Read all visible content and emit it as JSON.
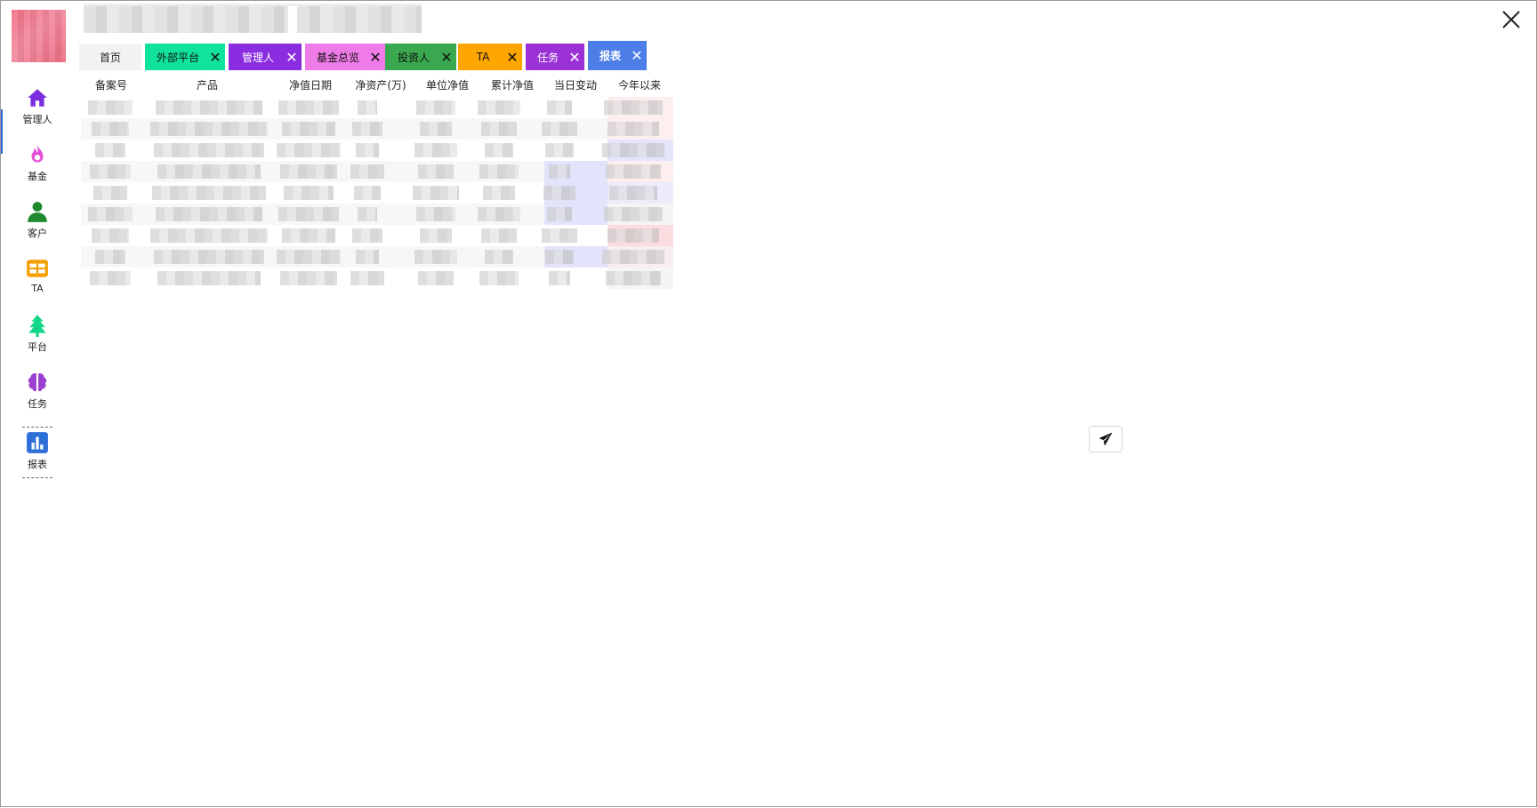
{
  "sidebar": {
    "items": [
      {
        "label": "管理人",
        "icon": "home-icon",
        "color": "#7a2ee0"
      },
      {
        "label": "基金",
        "icon": "fire-icon",
        "color": "#e34fd8"
      },
      {
        "label": "客户",
        "icon": "user-icon",
        "color": "#1f8a2e"
      },
      {
        "label": "TA",
        "icon": "table-icon",
        "color": "#f5a000"
      },
      {
        "label": "平台",
        "icon": "tree-icon",
        "color": "#14d68a"
      },
      {
        "label": "任务",
        "icon": "brain-icon",
        "color": "#9b3fd0"
      },
      {
        "label": "报表",
        "icon": "bar-chart-icon",
        "color": "#2f6fd8"
      }
    ]
  },
  "tabs": [
    {
      "label": "首页",
      "color": "#f2f2f2",
      "closable": false
    },
    {
      "label": "外部平台",
      "color": "#12e39a",
      "closable": true
    },
    {
      "label": "管理人",
      "color": "#8a2ce0",
      "closable": true
    },
    {
      "label": "基金总览",
      "color": "#ef7be8",
      "closable": true
    },
    {
      "label": "投资人",
      "color": "#3aa84f",
      "closable": true
    },
    {
      "label": "TA",
      "color": "#ffa500",
      "closable": true
    },
    {
      "label": "任务",
      "color": "#9a30d6",
      "closable": true
    },
    {
      "label": "报表",
      "color": "#4d7ee8",
      "closable": true,
      "active": true
    }
  ],
  "table": {
    "headers": [
      "备案号",
      "产品",
      "净值日期",
      "净资产(万)",
      "单位净值",
      "累计净值",
      "当日变动",
      "今年以来"
    ],
    "row_count": 9
  },
  "actions": {
    "send": "send-icon",
    "close": "close-icon"
  }
}
